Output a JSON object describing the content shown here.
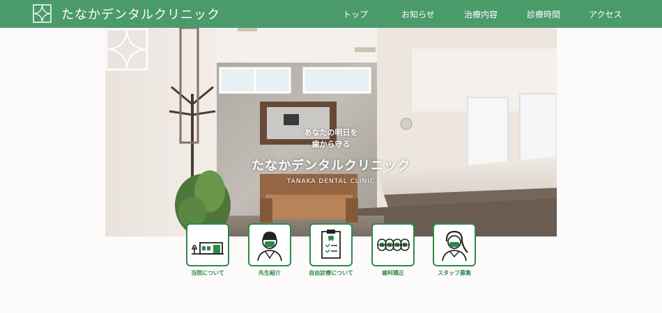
{
  "header": {
    "title": "たなかデンタルクリニック",
    "logo_icon": "clinic-star-logo-icon",
    "background": "#4a9a6a"
  },
  "nav": {
    "items": [
      {
        "label": "トップ"
      },
      {
        "label": "お知らせ"
      },
      {
        "label": "治療内容"
      },
      {
        "label": "診療時間"
      },
      {
        "label": "アクセス"
      }
    ]
  },
  "hero": {
    "tagline_line1": "あなたの明日を",
    "tagline_line2": "歯から守る",
    "title": "たなかデンタルクリニック",
    "subtitle": "TANAKA DENTAL CLINIC"
  },
  "features": {
    "accent": "#2c8a4a",
    "items": [
      {
        "label": "当院について",
        "icon": "clinic-building-icon"
      },
      {
        "label": "先生紹介",
        "icon": "doctor-icon"
      },
      {
        "label": "自由診療について",
        "icon": "clipboard-icon"
      },
      {
        "label": "歯科矯正",
        "icon": "braces-icon"
      },
      {
        "label": "スタッフ募集",
        "icon": "nurse-icon"
      }
    ]
  }
}
